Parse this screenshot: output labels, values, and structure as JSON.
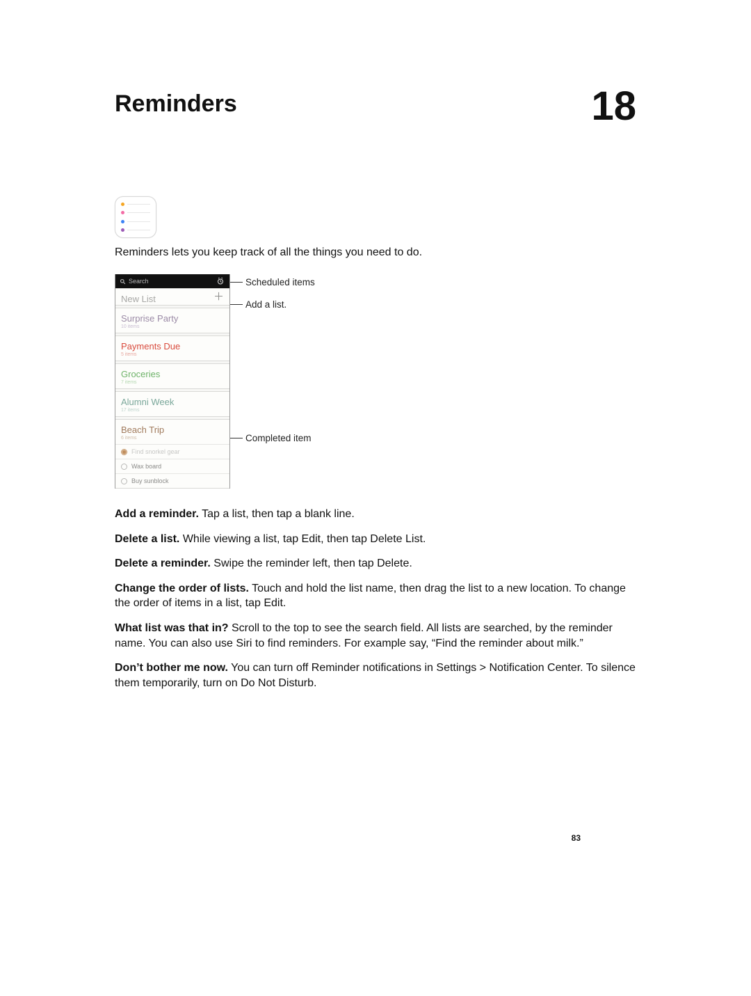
{
  "chapter": {
    "title": "Reminders",
    "number": "18"
  },
  "intro": "Reminders lets you keep track of all the things you need to do.",
  "search_placeholder": "Search",
  "newlist_label": "New List",
  "lists": [
    {
      "name": "Surprise Party",
      "count": "10 items",
      "cls": "purple"
    },
    {
      "name": "Payments Due",
      "count": "5 items",
      "cls": "red"
    },
    {
      "name": "Groceries",
      "count": "7 items",
      "cls": "green"
    },
    {
      "name": "Alumni Week",
      "count": "17 items",
      "cls": "teal"
    },
    {
      "name": "Beach Trip",
      "count": "6 items",
      "cls": "brown"
    }
  ],
  "reminders": [
    {
      "text": "Find snorkel gear",
      "done": true
    },
    {
      "text": "Wax board",
      "done": false
    },
    {
      "text": "Buy sunblock",
      "done": false
    }
  ],
  "callouts": {
    "scheduled": "Scheduled items",
    "addlist": "Add a list.",
    "completed": "Completed item"
  },
  "paras": [
    {
      "b": "Add a reminder.",
      "t": " Tap a list, then tap a blank line."
    },
    {
      "b": "Delete a list.",
      "t": " While viewing a list, tap Edit, then tap Delete List."
    },
    {
      "b": "Delete a reminder.",
      "t": " Swipe the reminder left, then tap Delete."
    },
    {
      "b": "Change the order of lists.",
      "t": " Touch and hold the list name, then drag the list to a new location. To change the order of items in a list, tap Edit."
    },
    {
      "b": "What list was that in?",
      "t": " Scroll to the top to see the search field. All lists are searched, by the reminder name. You can also use Siri to find reminders. For example say, “Find the reminder about milk.”"
    },
    {
      "b": "Don’t bother me now.",
      "t": " You can turn off Reminder notifications in Settings > Notification Center. To silence them temporarily, turn on Do Not Disturb."
    }
  ],
  "page_number": "83"
}
